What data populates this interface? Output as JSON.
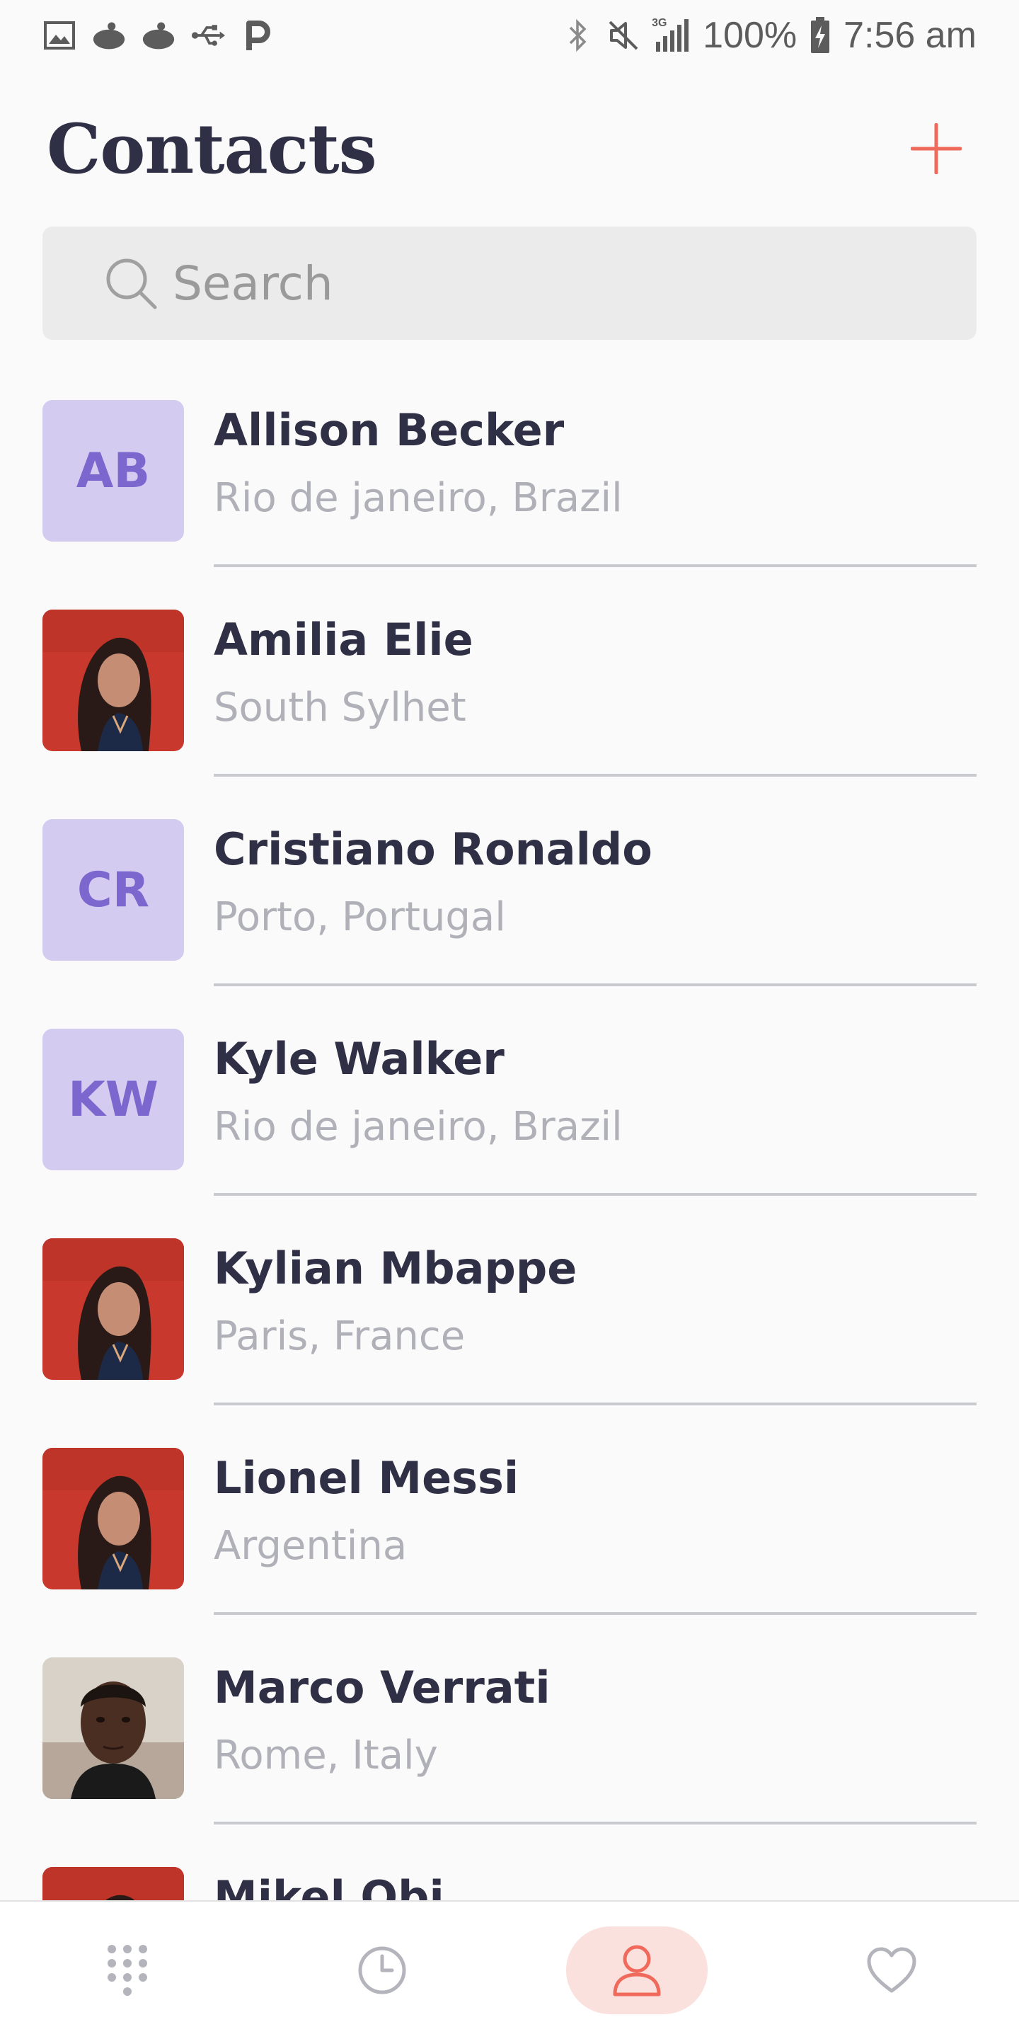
{
  "status_bar": {
    "battery_text": "100%",
    "time": "7:56 am",
    "network_label": "3G",
    "left_icons": [
      "image-icon",
      "cat-icon",
      "cat-icon",
      "usb-icon",
      "parking-icon"
    ],
    "right_icons": [
      "bluetooth-icon",
      "mute-icon",
      "signal-icon",
      "battery-charging-icon"
    ]
  },
  "header": {
    "title": "Contacts",
    "add_icon": "plus-icon",
    "accent_color": "#f06a5c"
  },
  "search": {
    "placeholder": "Search"
  },
  "contacts": [
    {
      "name": "Allison Becker",
      "location": "Rio de janeiro, Brazil",
      "initials": "AB",
      "avatar": "initials"
    },
    {
      "name": "Amilia Elie",
      "location": "South Sylhet",
      "initials": "",
      "avatar": "photo-woman"
    },
    {
      "name": "Cristiano Ronaldo",
      "location": "Porto, Portugal",
      "initials": "CR",
      "avatar": "initials"
    },
    {
      "name": "Kyle Walker",
      "location": "Rio de janeiro, Brazil",
      "initials": "KW",
      "avatar": "initials"
    },
    {
      "name": "Kylian Mbappe",
      "location": "Paris, France",
      "initials": "",
      "avatar": "photo-woman"
    },
    {
      "name": "Lionel Messi",
      "location": "Argentina",
      "initials": "",
      "avatar": "photo-woman"
    },
    {
      "name": "Marco Verrati",
      "location": "Rome, Italy",
      "initials": "",
      "avatar": "photo-man"
    },
    {
      "name": "Mikel Obi",
      "location": "",
      "initials": "",
      "avatar": "photo-woman"
    }
  ],
  "bottom_nav": {
    "items": [
      {
        "icon": "dialpad-icon",
        "active": false
      },
      {
        "icon": "clock-icon",
        "active": false
      },
      {
        "icon": "person-icon",
        "active": true
      },
      {
        "icon": "heart-icon",
        "active": false
      }
    ]
  },
  "colors": {
    "avatar_bg": "#d4ccf0",
    "avatar_text": "#7c67cf",
    "active_nav_bg": "#fbe1de",
    "active_nav_icon": "#f06a5c"
  }
}
